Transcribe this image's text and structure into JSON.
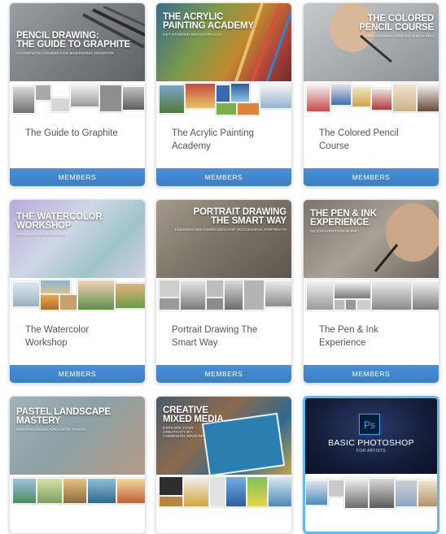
{
  "courses": [
    {
      "hero_title": "PENCIL DRAWING:\nTHE GUIDE TO GRAPHITE",
      "hero_subtitle": "A COMPLETE COURSE FOR MASTERING GRAPHITE",
      "title": "The Guide to Graphite",
      "button": "MEMBERS"
    },
    {
      "hero_title": "THE ACRYLIC\nPAINTING ACADEMY",
      "hero_subtitle": "GET STARTED WITH ACRYLICS",
      "title": "The Acrylic Painting\nAcademy",
      "button": "MEMBERS"
    },
    {
      "hero_title": "THE COLORED\nPENCIL COURSE",
      "hero_subtitle": "USE COLORED PENCILS LIKE A PRO",
      "title": "The Colored Pencil\nCourse",
      "button": "MEMBERS"
    },
    {
      "hero_title": "THE WATERCOLOR\nWORKSHOP",
      "hero_subtitle": "PAINT WITH CONFIDENCE",
      "title": "The Watercolor\nWorkshop",
      "button": "MEMBERS"
    },
    {
      "hero_title": "PORTRAIT DRAWING\nTHE SMART WAY",
      "hero_subtitle": "LESSONS AND EXERCISES FOR SUCCESSFUL PORTRAITS",
      "title": "Portrait Drawing The\nSmart Way",
      "button": "MEMBERS"
    },
    {
      "hero_title": "THE PEN & INK\nEXPERIENCE",
      "hero_subtitle": "AN EXPLORATION IN INK",
      "title": "The Pen & Ink\nExperience",
      "button": "MEMBERS"
    },
    {
      "hero_title": "PASTEL LANDSCAPE\nMASTERY",
      "hero_subtitle": "MASTER LANDSCAPES WITH PASTEL"
    },
    {
      "hero_title": "CREATIVE\nMIXED MEDIA",
      "hero_subtitle": "EXPLORE YOUR CREATIVITY BY COMBINING MEDIUMS"
    },
    {
      "logo_text": "Ps",
      "hero_title": "BASIC PHOTOSHOP",
      "hero_subtitle": "FOR ARTISTS"
    }
  ]
}
